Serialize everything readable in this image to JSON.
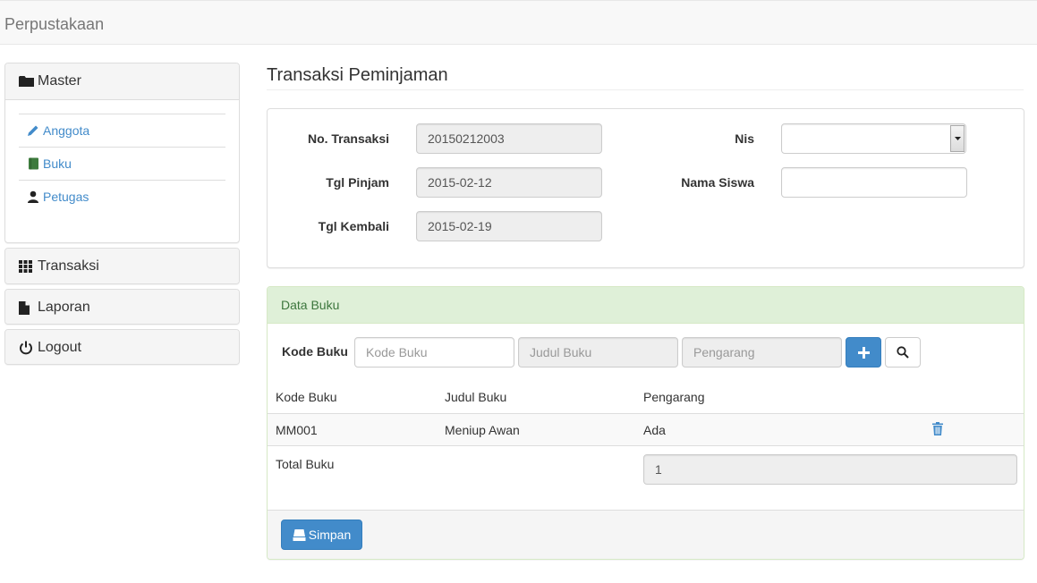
{
  "app": {
    "brand": "Perpustakaan"
  },
  "sidebar": {
    "master": {
      "label": "Master",
      "items": [
        {
          "label": "Anggota",
          "icon": "pencil-icon"
        },
        {
          "label": "Buku",
          "icon": "book-icon"
        },
        {
          "label": "Petugas",
          "icon": "user-icon"
        }
      ]
    },
    "transaksi": {
      "label": "Transaksi",
      "icon": "grid-icon"
    },
    "laporan": {
      "label": "Laporan",
      "icon": "file-icon"
    },
    "logout": {
      "label": "Logout",
      "icon": "power-icon"
    }
  },
  "main": {
    "title": "Transaksi Peminjaman",
    "form": {
      "no_transaksi_label": "No. Transaksi",
      "no_transaksi_value": "20150212003",
      "tgl_pinjam_label": "Tgl Pinjam",
      "tgl_pinjam_value": "2015-02-12",
      "tgl_kembali_label": "Tgl Kembali",
      "tgl_kembali_value": "2015-02-19",
      "nis_label": "Nis",
      "nis_value": "",
      "nama_siswa_label": "Nama Siswa",
      "nama_siswa_value": ""
    },
    "data_buku": {
      "heading": "Data Buku",
      "kode_buku_label": "Kode Buku",
      "kode_buku_placeholder": "Kode Buku",
      "judul_buku_placeholder": "Judul Buku",
      "pengarang_placeholder": "Pengarang",
      "columns": [
        "Kode Buku",
        "Judul Buku",
        "Pengarang"
      ],
      "rows": [
        {
          "kode": "MM001",
          "judul": "Meniup Awan",
          "pengarang": "Ada"
        }
      ],
      "total_label": "Total Buku",
      "total_value": "1"
    },
    "save_label": "Simpan"
  },
  "colors": {
    "primary": "#428bca",
    "success_bg": "#dff0d8",
    "success_text": "#3c763d",
    "link": "#428bca",
    "book_icon": "#3c7a3c"
  }
}
